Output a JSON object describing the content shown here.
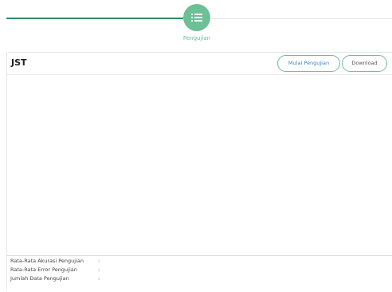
{
  "stepper": {
    "active_step_label": "Pengujian",
    "active_step_icon": "list-icon",
    "active_color": "#6dbf96",
    "line_color": "#2e8f5f"
  },
  "panel": {
    "title": "JST",
    "buttons": {
      "start_label": "Mulai Pengujian",
      "download_label": "Download"
    }
  },
  "stats": [
    {
      "label": "Rata-Rata Akurasi Pengujian",
      "separator": ":",
      "value": ""
    },
    {
      "label": "Rata-Rata Error Pengujian",
      "separator": ":",
      "value": ""
    },
    {
      "label": "Jumlah Data Pengujian",
      "separator": ":",
      "value": ""
    }
  ]
}
